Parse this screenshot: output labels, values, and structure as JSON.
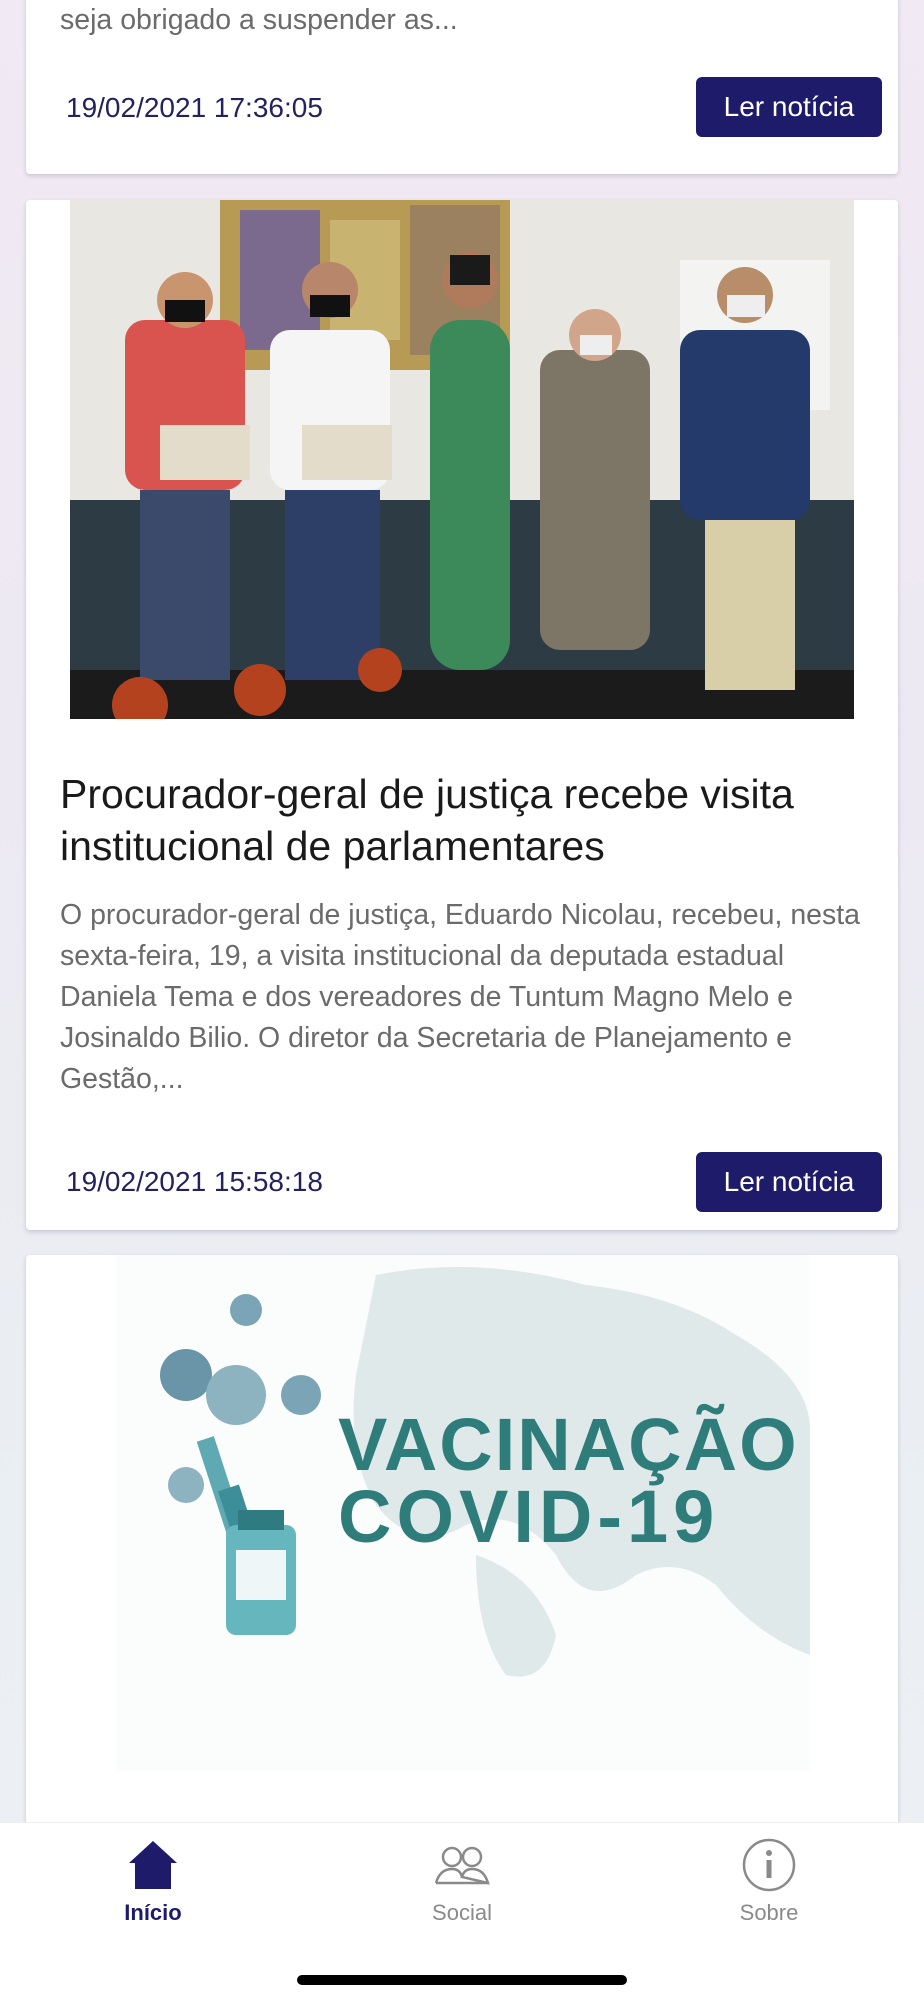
{
  "colors": {
    "accent": "#1e1b6b",
    "date_text": "#23215e",
    "excerpt_text": "#6b6b6b",
    "tab_inactive": "#8a8a8a",
    "vaccine_teal": "#2f7d7b"
  },
  "news": [
    {
      "excerpt": "seja obrigado a suspender as...",
      "date": "19/02/2021 17:36:05",
      "button_label": "Ler notícia"
    },
    {
      "image": "photo of a group of five people in an office",
      "title": "Procurador-geral de justiça recebe visita institucional de parlamentares",
      "excerpt": "O procurador-geral de justiça, Eduardo Nicolau, recebeu, nesta sexta-feira, 19, a visita institucional da deputada estadual Daniela Tema e dos vereadores de Tuntum Magno Melo e Josinaldo Bilio. O diretor da Secretaria de Planejamento e Gestão,...",
      "date": "19/02/2021 15:58:18",
      "button_label": "Ler notícia"
    },
    {
      "image_text_line1": "VACINAÇÃO",
      "image_text_line2": "COVID-19"
    }
  ],
  "tabbar": {
    "items": [
      {
        "label": "Início",
        "icon": "home-icon",
        "active": true
      },
      {
        "label": "Social",
        "icon": "people-icon",
        "active": false
      },
      {
        "label": "Sobre",
        "icon": "info-icon",
        "active": false
      }
    ]
  }
}
